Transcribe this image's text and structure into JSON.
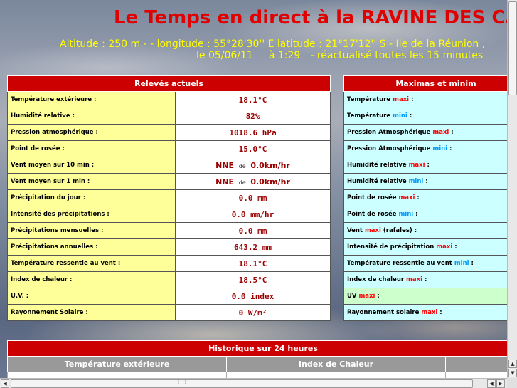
{
  "header": {
    "title": "Le Temps en direct à la RAVINE DES CA",
    "location_line": "Altitude : 250 m -  - longitude : 55°28'30'' E   latitude  : 21°17'12'' S  - Ile de la Réunion ,",
    "date_label": "le  05/06/11",
    "time_label": "à 1:29",
    "refresh_note": "- réactualisé toutes les 15 minutes"
  },
  "current": {
    "title": "Relevés actuels",
    "rows": [
      {
        "label": "Température extérieure :",
        "value": "18.1°C"
      },
      {
        "label": "Humidité relative :",
        "value": "82%"
      },
      {
        "label": "Pression atmosphérique :",
        "value": "1018.6 hPa"
      },
      {
        "label": "Point de rosée :",
        "value": "15.0°C"
      },
      {
        "label": "Vent moyen sur 10 min :",
        "dir": "NNE",
        "de": "de",
        "speed": "0.0km/hr"
      },
      {
        "label": "Vent moyen sur 1 min :",
        "dir": "NNE",
        "de": "de",
        "speed": "0.0km/hr"
      },
      {
        "label": "Précipitation du jour :",
        "value": "0.0 mm"
      },
      {
        "label": "Intensité des précipitations :",
        "value": "0.0 mm/hr"
      },
      {
        "label": "Précipitations mensuelles :",
        "value": "0.0 mm"
      },
      {
        "label": "Précipitations annuelles :",
        "value": "643.2 mm"
      },
      {
        "label": "Température ressentie au vent :",
        "value": "18.1°C"
      },
      {
        "label": "Index de chaleur :",
        "value": "18.5°C"
      },
      {
        "label": "U.V. :",
        "value": "0.0 index"
      },
      {
        "label": "Rayonnement Solaire :",
        "value": "0 W/m²"
      }
    ]
  },
  "extremes": {
    "title": "Maximas et minim",
    "rows": [
      {
        "pre": "Température ",
        "kw": "maxi",
        "post": " :"
      },
      {
        "pre": "Température ",
        "kw": "mini",
        "post": " :"
      },
      {
        "pre": "Pression Atmosphérique ",
        "kw": "maxi",
        "post": " :"
      },
      {
        "pre": "Pression Atmosphérique ",
        "kw": "mini",
        "post": " :"
      },
      {
        "pre": "Humidité relative ",
        "kw": "maxi",
        "post": " :"
      },
      {
        "pre": "Humidité relative ",
        "kw": "mini",
        "post": " :"
      },
      {
        "pre": "Point de rosée ",
        "kw": "maxi",
        "post": " :"
      },
      {
        "pre": "Point de rosée ",
        "kw": "mini",
        "post": " :"
      },
      {
        "pre": "Vent ",
        "kw": "maxi",
        "post": " (rafales) :"
      },
      {
        "pre": "Intensité de précipitation ",
        "kw": "maxi",
        "post": " :"
      },
      {
        "pre": "Température ressentie au vent ",
        "kw": "mini",
        "post": " :"
      },
      {
        "pre": "Index de chaleur ",
        "kw": "maxi",
        "post": " :"
      },
      {
        "pre": "UV ",
        "kw": "maxi",
        "post": " :"
      },
      {
        "pre": "Rayonnement solaire ",
        "kw": "maxi",
        "post": " :"
      }
    ]
  },
  "history": {
    "title": "Historique sur 24 heures",
    "columns": [
      "Température extérieure",
      "Index de Chaleur"
    ]
  },
  "colors": {
    "title": "#e00000",
    "subtitle": "#ffff00",
    "header_bg": "#cc0000",
    "label_bg": "#ffff99",
    "extremes_bg": "#ccffff",
    "maxi": "#ff0000",
    "mini": "#0099ff"
  }
}
